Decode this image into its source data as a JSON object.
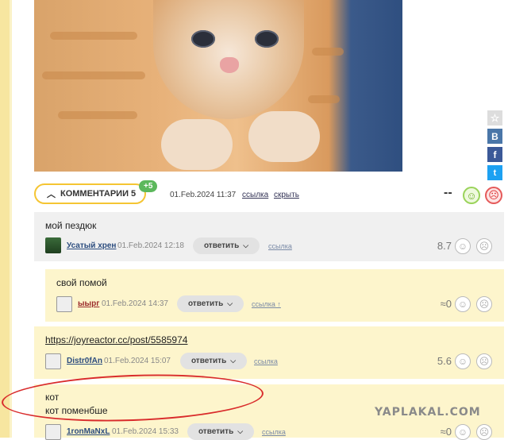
{
  "post": {
    "image_alt": "ginger kitten",
    "share": {
      "star": "☆",
      "vk": "B",
      "fb": "f",
      "tw": "t"
    },
    "comments_label": "КОММЕНТАРИИ 5",
    "new_badge": "+5",
    "date": "01.Feb.2024 11:37",
    "link_label": "ссылка",
    "hide_label": "скрыть",
    "rating": "--"
  },
  "reply_label": "ответить",
  "link_label": "ссылка",
  "comments": [
    {
      "text": "мой пездюк",
      "user": "Усатый хрен",
      "date": "01.Feb.2024 12:18",
      "link": "ссылка",
      "rating": "8.7"
    },
    {
      "text": "свой помой",
      "user": "ыырг",
      "date": "01.Feb.2024 14:37",
      "link": "ссылка ↑",
      "rating": "≈0"
    },
    {
      "text": "https://joyreactor.cc/post/5585974",
      "user": "Distr0fAn",
      "date": "01.Feb.2024 15:07",
      "link": "ссылка",
      "rating": "5.6"
    },
    {
      "text_line1": "кот",
      "text_line2": "кот поменбше",
      "user": "1ronMaNxL",
      "date": "01.Feb.2024 15:33",
      "link": "ссылка",
      "rating": "≈0"
    }
  ],
  "watermark": "YAPLAKAL.COM",
  "colors": {
    "accent_yellow": "#f5c533",
    "badge_green": "#5cb85c",
    "comment_bg": "#fdf5cc",
    "highlight_red": "#d92b2b"
  }
}
